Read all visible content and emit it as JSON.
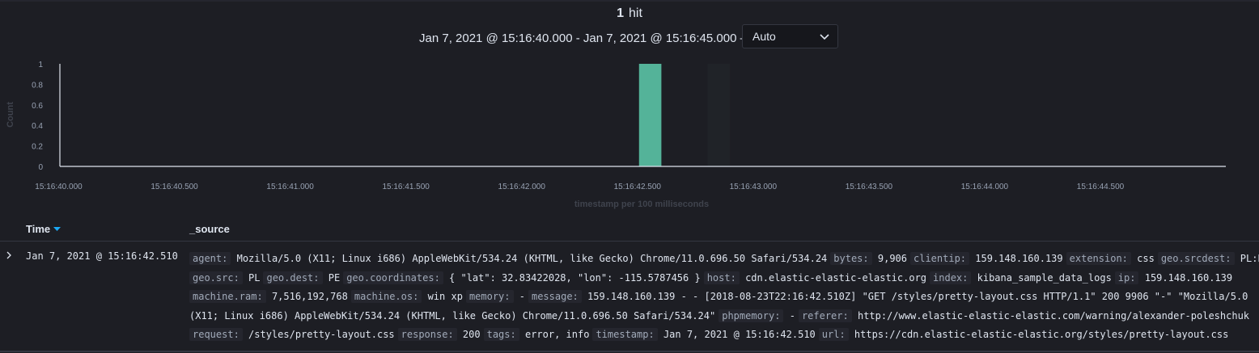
{
  "header": {
    "hit_count": "1",
    "hit_label": "hit",
    "time_range": "Jan 7, 2021 @ 15:16:40.000 - Jan 7, 2021 @ 15:16:45.000 —",
    "interval": "Auto"
  },
  "chart_data": {
    "type": "bar",
    "ylabel": "Count",
    "xlabel": "timestamp per 100 milliseconds",
    "ylim": [
      0,
      1
    ],
    "yticks": [
      "0",
      "0.2",
      "0.4",
      "0.6",
      "0.8",
      "1"
    ],
    "xticks": [
      "15:16:40.000",
      "15:16:40.500",
      "15:16:41.000",
      "15:16:41.500",
      "15:16:42.000",
      "15:16:42.500",
      "15:16:43.000",
      "15:16:43.500",
      "15:16:44.000",
      "15:16:44.500"
    ],
    "x_range_seconds": [
      40.0,
      45.0
    ],
    "bars": [
      {
        "x": "15:16:42.500",
        "value": 1
      }
    ],
    "highlight_bucket": "15:16:42.800",
    "bar_color": "#54b399",
    "grid": false
  },
  "table": {
    "columns": [
      "Time",
      "_source"
    ],
    "row": {
      "time": "Jan 7, 2021 @ 15:16:42.510",
      "lines": [
        [
          [
            "agent:",
            "Mozilla/5.0 (X11; Linux i686) AppleWebKit/534.24 (KHTML, like Gecko) Chrome/11.0.696.50 Safari/534.24"
          ],
          [
            "bytes:",
            "9,906"
          ],
          [
            "clientip:",
            "159.148.160.139"
          ],
          [
            "extension:",
            "css"
          ],
          [
            "geo.srcdest:",
            "PL:PE"
          ]
        ],
        [
          [
            "geo.src:",
            "PL"
          ],
          [
            "geo.dest:",
            "PE"
          ],
          [
            "geo.coordinates:",
            "{ \"lat\": 32.83422028, \"lon\": -115.5787456 }"
          ],
          [
            "host:",
            "cdn.elastic-elastic-elastic.org"
          ],
          [
            "index:",
            "kibana_sample_data_logs"
          ],
          [
            "ip:",
            "159.148.160.139"
          ]
        ],
        [
          [
            "machine.ram:",
            "7,516,192,768"
          ],
          [
            "machine.os:",
            "win xp"
          ],
          [
            "memory:",
            " -"
          ],
          [
            "message:",
            "159.148.160.139 - - [2018-08-23T22:16:42.510Z] \"GET /styles/pretty-layout.css HTTP/1.1\" 200 9906 \"-\" \"Mozilla/5.0"
          ]
        ],
        [
          [
            "",
            "(X11; Linux i686) AppleWebKit/534.24 (KHTML, like Gecko) Chrome/11.0.696.50 Safari/534.24\""
          ],
          [
            "phpmemory:",
            " -"
          ],
          [
            "referer:",
            "http://www.elastic-elastic-elastic.com/warning/alexander-poleshchuk"
          ]
        ],
        [
          [
            "request:",
            "/styles/pretty-layout.css"
          ],
          [
            "response:",
            "200"
          ],
          [
            "tags:",
            "error, info"
          ],
          [
            "timestamp:",
            "Jan 7, 2021 @ 15:16:42.510"
          ],
          [
            "url:",
            "https://cdn.elastic-elastic-elastic.org/styles/pretty-layout.css"
          ]
        ]
      ]
    }
  }
}
